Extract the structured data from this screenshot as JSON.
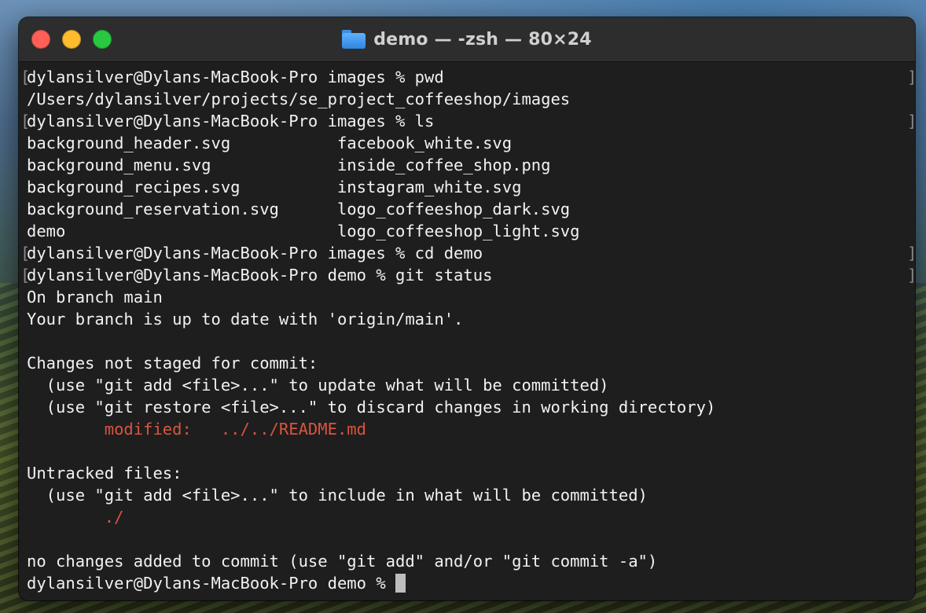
{
  "window": {
    "title": "demo — -zsh — 80×24",
    "traffic_lights": [
      "#ff5f57",
      "#febc2e",
      "#28c840"
    ]
  },
  "terminal": {
    "lines": [
      {
        "text": "dylansilver@Dylans-MacBook-Pro images % pwd",
        "kind": "prompt"
      },
      {
        "text": "/Users/dylansilver/projects/se_project_coffeeshop/images",
        "kind": "output"
      },
      {
        "text": "dylansilver@Dylans-MacBook-Pro images % ls",
        "kind": "prompt"
      },
      {
        "text": "background_header.svg           facebook_white.svg",
        "kind": "output"
      },
      {
        "text": "background_menu.svg             inside_coffee_shop.png",
        "kind": "output"
      },
      {
        "text": "background_recipes.svg          instagram_white.svg",
        "kind": "output"
      },
      {
        "text": "background_reservation.svg      logo_coffeeshop_dark.svg",
        "kind": "output"
      },
      {
        "text": "demo                            logo_coffeeshop_light.svg",
        "kind": "output"
      },
      {
        "text": "dylansilver@Dylans-MacBook-Pro images % cd demo",
        "kind": "prompt"
      },
      {
        "text": "dylansilver@Dylans-MacBook-Pro demo % git status",
        "kind": "prompt"
      },
      {
        "text": "On branch main",
        "kind": "output"
      },
      {
        "text": "Your branch is up to date with 'origin/main'.",
        "kind": "output"
      },
      {
        "text": "",
        "kind": "output"
      },
      {
        "text": "Changes not staged for commit:",
        "kind": "output"
      },
      {
        "text": "  (use \"git add <file>...\" to update what will be committed)",
        "kind": "output"
      },
      {
        "text": "  (use \"git restore <file>...\" to discard changes in working directory)",
        "kind": "output"
      },
      {
        "text": "        modified:   ../../README.md",
        "kind": "red"
      },
      {
        "text": "",
        "kind": "output"
      },
      {
        "text": "Untracked files:",
        "kind": "output"
      },
      {
        "text": "  (use \"git add <file>...\" to include in what will be committed)",
        "kind": "output"
      },
      {
        "text": "        ./",
        "kind": "red"
      },
      {
        "text": "",
        "kind": "output"
      },
      {
        "text": "no changes added to commit (use \"git add\" and/or \"git commit -a\")",
        "kind": "output"
      },
      {
        "text": "dylansilver@Dylans-MacBook-Pro demo % ",
        "kind": "current"
      }
    ],
    "colors": {
      "foreground": "#f2f2f2",
      "red": "#d9553f",
      "background": "#1e1e1e"
    }
  }
}
